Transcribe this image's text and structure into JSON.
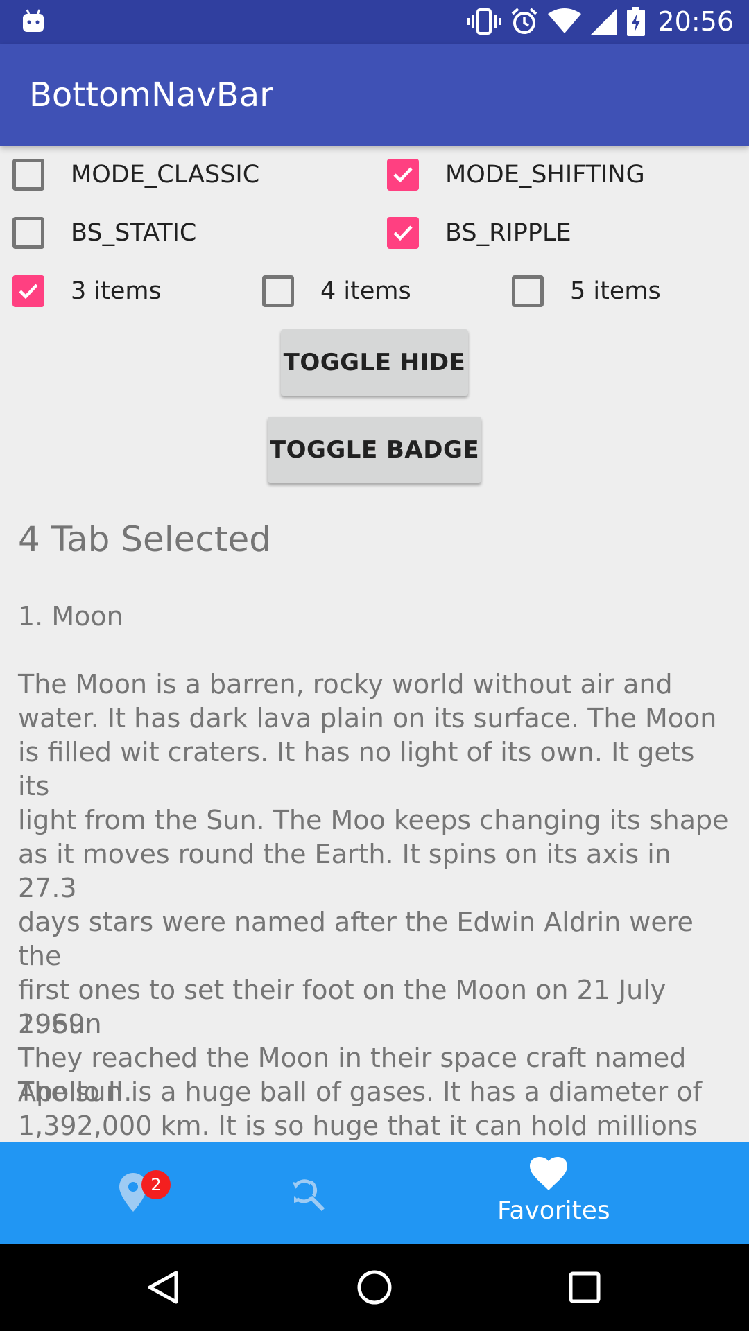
{
  "status_bar": {
    "time": "20:56"
  },
  "app_bar": {
    "title": "BottomNavBar"
  },
  "options": {
    "mode_classic": {
      "label": "MODE_CLASSIC",
      "checked": false
    },
    "mode_shifting": {
      "label": "MODE_SHIFTING",
      "checked": true
    },
    "bs_static": {
      "label": "BS_STATIC",
      "checked": false
    },
    "bs_ripple": {
      "label": "BS_RIPPLE",
      "checked": true
    },
    "items_3": {
      "label": "3 items",
      "checked": true
    },
    "items_4": {
      "label": "4 items",
      "checked": false
    },
    "items_5": {
      "label": "5 items",
      "checked": false
    }
  },
  "buttons": {
    "toggle_hide": "TOGGLE HIDE",
    "toggle_badge": "TOGGLE BADGE"
  },
  "content": {
    "tab_selected": "4 Tab Selected",
    "moon_heading": "1. Moon",
    "moon_text": "The Moon is a barren, rocky world without air and\nwater. It has dark lava plain on its surface. The Moon\nis filled wit craters. It has no light of its own. It gets its\nlight from the Sun. The Moo keeps changing its shape\nas it moves round the Earth. It spins on its axis in 27.3\ndays stars were named after the Edwin Aldrin were the\nfirst ones to set their foot on the Moon on 21 July 1969\nThey reached the Moon in their space craft named\nApollo II.",
    "sun_heading": "2. Sun",
    "sun_text": "The sun is a huge ball of gases. It has a diameter of\n1,392,000 km. It is so huge that it can hold millions"
  },
  "bottom_nav": {
    "color": "#2196f3",
    "items": [
      {
        "icon": "location-pin-icon",
        "badge": "2"
      },
      {
        "icon": "find-replace-icon"
      },
      {
        "icon": "heart-icon",
        "label": "Favorites",
        "active": true
      }
    ]
  },
  "colors": {
    "status_bar": "#303f9f",
    "app_bar": "#3f51b5",
    "accent": "#ff4081",
    "badge": "#f41f1f"
  }
}
